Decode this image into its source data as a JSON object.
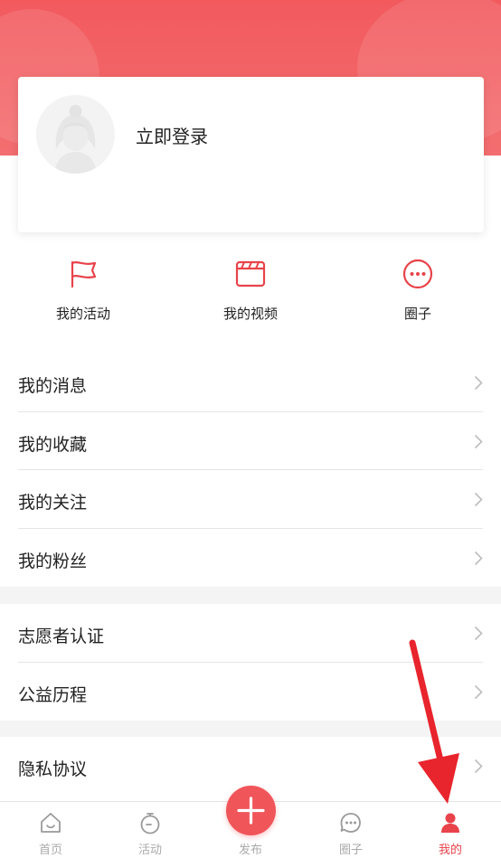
{
  "profile": {
    "login_label": "立即登录"
  },
  "quick_actions": [
    {
      "label": "我的活动",
      "icon": "flag-icon"
    },
    {
      "label": "我的视频",
      "icon": "clapperboard-icon"
    },
    {
      "label": "圈子",
      "icon": "chat-bubble-icon"
    }
  ],
  "menu_group1": [
    {
      "label": "我的消息"
    },
    {
      "label": "我的收藏"
    },
    {
      "label": "我的关注"
    },
    {
      "label": "我的粉丝"
    }
  ],
  "menu_group2": [
    {
      "label": "志愿者认证"
    },
    {
      "label": "公益历程"
    }
  ],
  "menu_group3": [
    {
      "label": "隐私协议"
    }
  ],
  "tabbar": {
    "tabs": [
      {
        "label": "首页",
        "icon": "home-icon"
      },
      {
        "label": "活动",
        "icon": "stopwatch-icon"
      },
      {
        "label": "发布",
        "icon": "plus-icon"
      },
      {
        "label": "圈子",
        "icon": "chat-bubble-icon"
      },
      {
        "label": "我的",
        "icon": "user-icon"
      }
    ],
    "active": "我的"
  },
  "colors": {
    "accent": "#e8434a",
    "header_gradient_top": "#f25a5e",
    "header_gradient_bottom": "#f36e70",
    "annotation_arrow": "#e8242c"
  }
}
